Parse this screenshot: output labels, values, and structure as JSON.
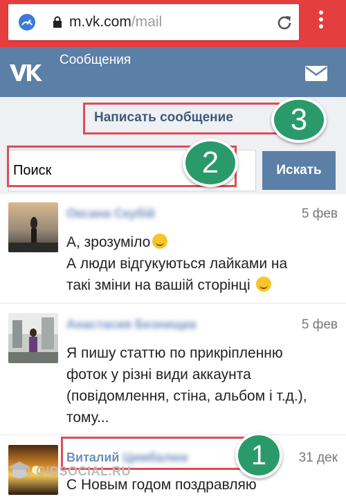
{
  "browser": {
    "url_host": "m.vk.com",
    "url_path": "/mail"
  },
  "header": {
    "title": "Сообщения"
  },
  "compose": {
    "label": "Написать сообщение"
  },
  "search": {
    "value": "Поиск",
    "button_label": "Искать"
  },
  "badges": {
    "one": "1",
    "two": "2",
    "three": "3"
  },
  "dialogs": [
    {
      "name": "Оксана Скубій",
      "date": "5 фев",
      "line1": "А, зрозуміло",
      "line2": "А люди відгукуються лайками на",
      "line3": "такі зміни на вашій сторінці"
    },
    {
      "name": "Анастасия Безнищка",
      "date": "5 фев",
      "line1": "Я пишу статтю по прикріпленню",
      "line2": "фоток у різні види аккаунта",
      "line3": "(повідомлення, стіна, альбом і т.д.),",
      "line4": "тому..."
    },
    {
      "name_visible": "Виталий",
      "name_blurred": "Цимбалюк",
      "date": "31 дек",
      "line1": "С Новым годом поздравляю"
    }
  ],
  "watermark": "GIDSOCIAL.RU",
  "colors": {
    "chrome_red": "#e53e3e",
    "vk_blue": "#5b7fa6",
    "highlight_red": "#e04b55",
    "badge_green": "#2a9a6a"
  }
}
